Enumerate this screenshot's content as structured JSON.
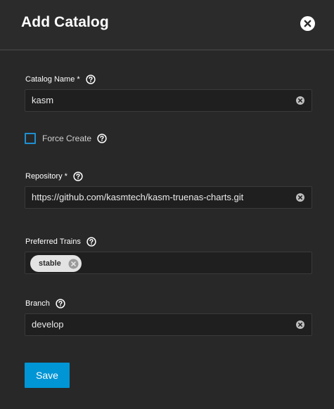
{
  "dialog": {
    "title": "Add Catalog",
    "close_icon": "close-icon"
  },
  "form": {
    "catalog_name": {
      "label": "Catalog Name *",
      "value": "kasm",
      "help_icon": "help-icon",
      "clear_icon": "clear-icon"
    },
    "force_create": {
      "label": "Force Create",
      "checked": false,
      "help_icon": "help-icon"
    },
    "repository": {
      "label": "Repository *",
      "value": "https://github.com/kasmtech/kasm-truenas-charts.git",
      "help_icon": "help-icon",
      "clear_icon": "clear-icon"
    },
    "preferred_trains": {
      "label": "Preferred Trains",
      "chips": [
        "stable"
      ],
      "help_icon": "help-icon"
    },
    "branch": {
      "label": "Branch",
      "value": "develop",
      "help_icon": "help-icon",
      "clear_icon": "clear-icon"
    },
    "save_label": "Save"
  },
  "colors": {
    "background": "#282828",
    "field_background": "#1f1f1f",
    "accent": "#0095d5",
    "checkbox_border": "#1e8fd1",
    "chip_background": "#e3e3e3"
  }
}
